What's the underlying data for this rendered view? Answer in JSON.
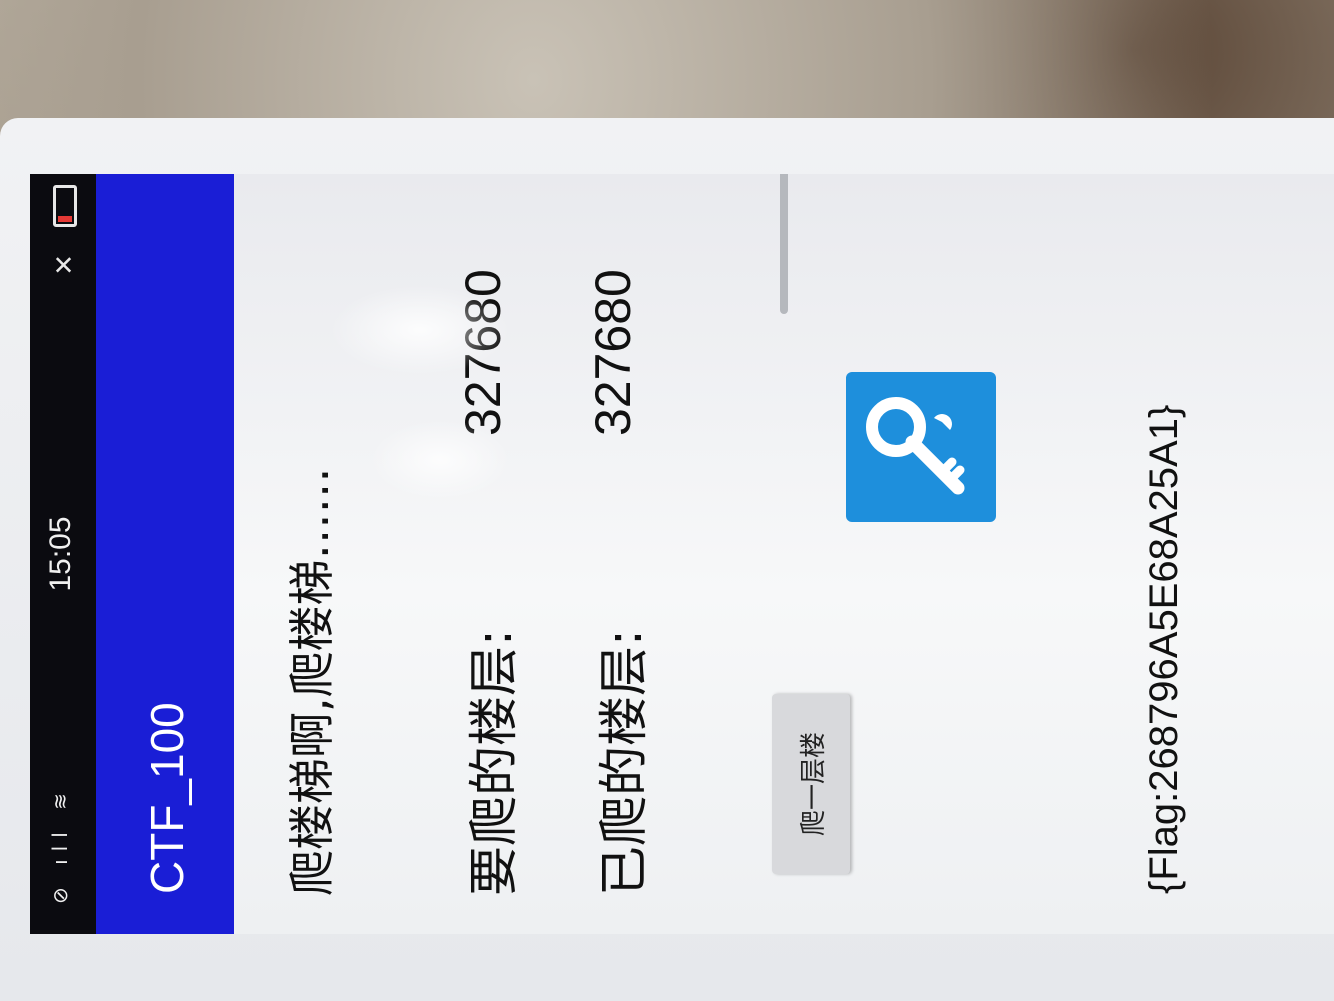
{
  "status_bar": {
    "time": "15:05",
    "left_icons": "⊘ ıll ≋",
    "mute_icon": "🔇"
  },
  "app_bar": {
    "title": "CTF_100"
  },
  "main": {
    "headline": "爬楼梯啊,爬楼梯……",
    "target_floor_label": "要爬的楼层:",
    "target_floor_value": "327680",
    "climbed_floor_label": "已爬的楼层:",
    "climbed_floor_value": "327680",
    "climb_button_label": "爬一层楼",
    "progress_fraction": 1.0,
    "flag": "{Flag:268796A5E68A25A1}"
  },
  "colors": {
    "app_bar": "#1a1ed6",
    "key_icon_bg": "#1e8fdc",
    "battery_low": "#e53935"
  },
  "icons": {
    "key": "key-icon",
    "battery": "battery-icon",
    "wifi": "wifi-icon",
    "mute": "mute-icon"
  }
}
